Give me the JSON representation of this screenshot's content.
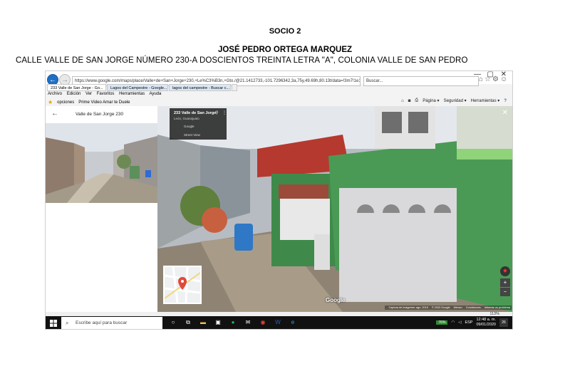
{
  "document": {
    "heading1": "SOCIO 2",
    "heading2": "JOSÉ PEDRO ORTEGA MARQUEZ",
    "heading3": "CALLE VALLE DE SAN JORGE NÚMERO 230-A DOSCIENTOS TREINTA LETRA \"A\", COLONIA VALLE DE SAN PEDRO"
  },
  "browser": {
    "address": "https://www.google.com/maps/place/Valle+de+San+Jorge+230,+Le%C3%B3n,+Gto./@21.1412733,-101.7296342,3a,75y,49.69h,80.13t/data=!3m7!1e1!3m5!1sMDn5!",
    "search_placeholder": "Buscar...",
    "tabs": [
      {
        "label": "233 Valle de San Jorge - Go..."
      },
      {
        "label": "Lagos del Campestre - Google..."
      },
      {
        "label": "lagos del campestre - Buscar c..."
      }
    ],
    "menu": [
      "Archivo",
      "Edición",
      "Ver",
      "Favoritos",
      "Herramientas",
      "Ayuda"
    ],
    "favorites": [
      "opciones",
      "Prime Video Amar te Duele"
    ],
    "command_bar": [
      "Página ▾",
      "Seguridad ▾",
      "Herramientas ▾"
    ]
  },
  "maps": {
    "panel_title": "Valle de San Jorge 230",
    "card_title": "233 Valle de San Jorge",
    "card_sub": "León, Guanajuato",
    "card_google": "Google",
    "card_sv": "Street View",
    "watermark": "Google",
    "footer": [
      "Captura de imágenes: ago. 2015",
      "© 2020 Google",
      "México",
      "Condiciones",
      "Informar un problema"
    ],
    "zoom": "113%"
  },
  "taskbar": {
    "search_placeholder": "Escribe aquí para buscar",
    "battery": "76%",
    "lang": "ESP",
    "time": "12:48 a. m.",
    "date": "09/01/2020",
    "notif": "26"
  },
  "colors": {
    "accent": "#1f6fc5",
    "house_green": "#3f8a4a",
    "roof": "#b5392f"
  }
}
